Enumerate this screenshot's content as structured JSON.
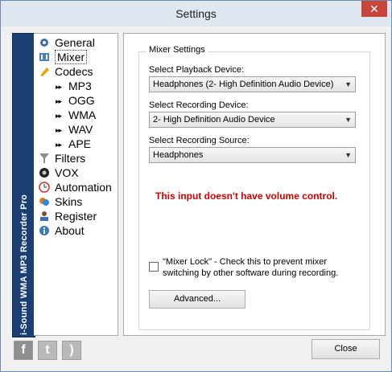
{
  "window": {
    "title": "Settings",
    "close_glyph": "✕"
  },
  "banner": {
    "text": "i-Sound WMA MP3 Recorder Pro"
  },
  "tree": {
    "items": [
      {
        "label": "General",
        "icon": "gear-icon"
      },
      {
        "label": "Mixer",
        "icon": "mixer-icon",
        "selected": true
      },
      {
        "label": "Codecs",
        "icon": "codecs-icon"
      },
      {
        "label": "MP3",
        "icon": "arrow-icon"
      },
      {
        "label": "OGG",
        "icon": "arrow-icon"
      },
      {
        "label": "WMA",
        "icon": "arrow-icon"
      },
      {
        "label": "WAV",
        "icon": "arrow-icon"
      },
      {
        "label": "APE",
        "icon": "arrow-icon"
      },
      {
        "label": "Filters",
        "icon": "filter-icon"
      },
      {
        "label": "VOX",
        "icon": "vox-icon"
      },
      {
        "label": "Automation",
        "icon": "clock-icon"
      },
      {
        "label": "Skins",
        "icon": "skins-icon"
      },
      {
        "label": "Register",
        "icon": "register-icon"
      },
      {
        "label": "About",
        "icon": "info-icon"
      }
    ]
  },
  "mixer": {
    "group_title": "Mixer Settings",
    "playback_label": "Select Playback Device:",
    "playback_value": "Headphones (2- High Definition Audio Device)",
    "recording_label": "Select Recording Device:",
    "recording_value": "2- High Definition Audio Device",
    "source_label": "Select Recording Source:",
    "source_value": "Headphones",
    "warning": "This input doesn't have volume control.",
    "lock_label": "\"Mixer Lock\" - Check this to prevent mixer switching by other software during recording.",
    "lock_checked": false,
    "advanced_label": "Advanced..."
  },
  "footer": {
    "close_label": "Close",
    "social": [
      {
        "name": "facebook-icon",
        "glyph": "f"
      },
      {
        "name": "twitter-icon",
        "glyph": "t"
      },
      {
        "name": "rss-icon",
        "glyph": ")"
      }
    ]
  }
}
